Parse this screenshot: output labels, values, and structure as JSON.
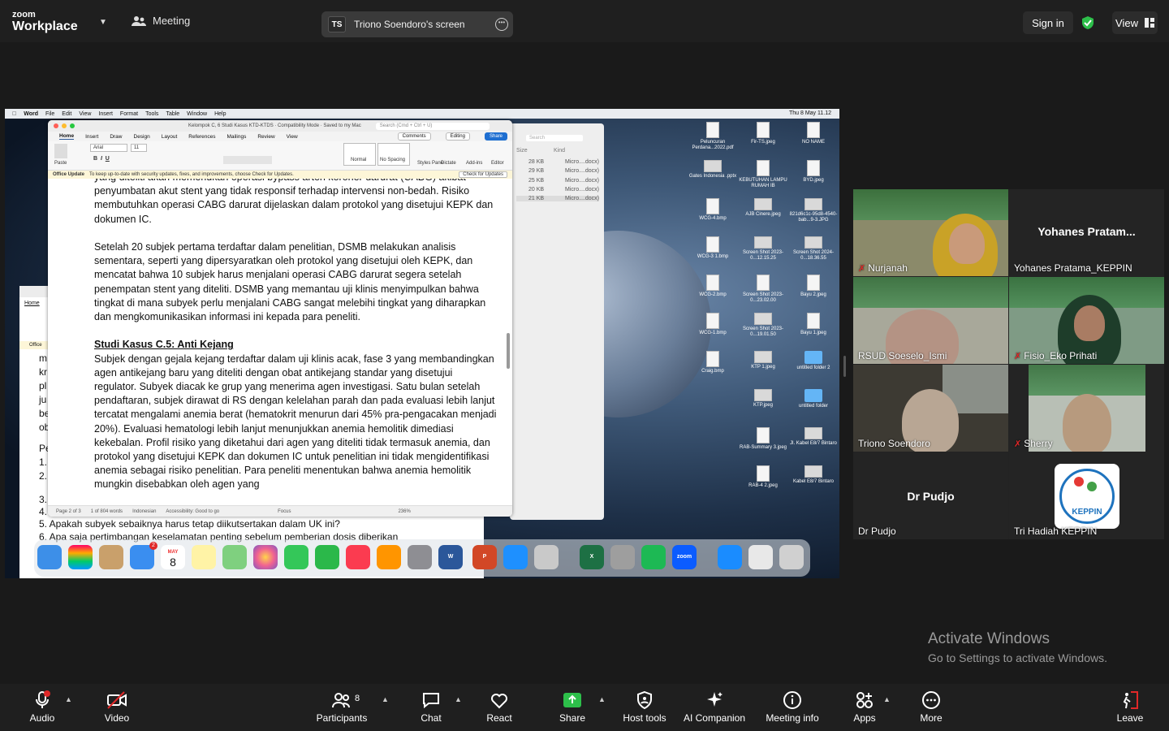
{
  "app": {
    "logo_line1": "zoom",
    "logo_line2": "Workplace",
    "meeting_label": "Meeting"
  },
  "share": {
    "initials": "TS",
    "label": "Triono Soendoro's screen"
  },
  "header_right": {
    "signin_label": "Sign in",
    "view_label": "View"
  },
  "mac": {
    "menus": [
      "Word",
      "File",
      "Edit",
      "View",
      "Insert",
      "Format",
      "Tools",
      "Table",
      "Window",
      "Help"
    ],
    "clock": "Thu 8 May 11.12"
  },
  "word": {
    "title": "Kelompok C, 6 Studi Kasus KTD-KTDS  ·  Compatibility Mode  ·  Saved to my Mac",
    "search_placeholder": "Search (Cmd + Ctrl + U)",
    "tabs": [
      "Home",
      "Insert",
      "Draw",
      "Design",
      "Layout",
      "References",
      "Mailings",
      "Review",
      "View"
    ],
    "comments_label": "Comments",
    "editing_label": "Editing",
    "share_label": "Share",
    "font": "Arial",
    "font_size": "11",
    "styles": [
      "Normal",
      "No Spacing"
    ],
    "ribbon_labels": [
      "Paste",
      "Styles Pane",
      "Dictate",
      "Add-ins",
      "Editor"
    ],
    "notice_title": "Office Update",
    "notice_text": "To keep up-to-date with security updates, fixes, and improvements, choose Check for Updates.",
    "notice_button": "Check for Updates",
    "paragraphs": [
      "yang diteliti akan memerlukan operasi bypass arteri koroner darurat (CABG) akibat penyumbatan akut stent yang tidak responsif terhadap intervensi non-bedah. Risiko membutuhkan operasi CABG darurat dijelaskan dalam protokol yang disetujui KEPK dan dokumen IC.",
      "Setelah 20 subjek pertama terdaftar dalam penelitian, DSMB melakukan analisis sementara, seperti yang dipersyaratkan oleh protokol yang disetujui oleh KEPK, dan mencatat bahwa 10 subjek harus menjalani operasi CABG darurat segera setelah penempatan stent yang diteliti. DSMB yang memantau uji klinis menyimpulkan bahwa tingkat di mana subyek perlu menjalani CABG sangat melebihi tingkat yang diharapkan dan mengkomunikasikan informasi ini kepada para peneliti."
    ],
    "heading": "Studi Kasus C.5: Anti Kejang",
    "paragraph3": "Subjek dengan gejala kejang terdaftar dalam uji klinis acak, fase 3 yang membandingkan agen antikejang baru yang diteliti dengan obat antikejang standar yang disetujui regulator. Subyek diacak ke grup yang menerima agen investigasi. Satu bulan setelah pendaftaran, subjek dirawat di RS dengan kelelahan parah dan pada evaluasi lebih lanjut tercatat mengalami anemia berat (hematokrit menurun dari 45% pra-pengacakan menjadi 20%). Evaluasi hematologi lebih lanjut menunjukkan anemia hemolitik dimediasi kekebalan. Profil risiko yang diketahui dari agen yang diteliti tidak termasuk anemia, dan protokol yang disetujui KEPK dan dokumen IC untuk penelitian ini tidak mengidentifikasi anemia sebagai risiko penelitian. Para peneliti menentukan bahwa anemia hemolitik mungkin disebabkan oleh agen yang",
    "status": [
      "Page 2 of 3",
      "1 of 804 words",
      "Indonesian",
      "Accessibility: Good to go",
      "Focus",
      "236%"
    ]
  },
  "doc_behind": {
    "tab": "Home",
    "notice": "Office",
    "lines_left": [
      "m",
      "kr",
      "pl",
      "ju",
      "be",
      "ob",
      "Pe",
      "1.",
      "2.",
      "3.",
      "4."
    ],
    "lines": [
      "5.   Apakah subyek sebaiknya harus tetap diikutsertakan dalam UK ini?",
      "6.   Apa saja pertimbangan keselamatan penting sebelum pemberian dosis diberikan"
    ]
  },
  "finder": {
    "search": "Search",
    "col_size": "Size",
    "col_kind": "Kind",
    "rows": [
      {
        "size": "28 KB",
        "kind": "Micro....docx)"
      },
      {
        "size": "29 KB",
        "kind": "Micro....docx)"
      },
      {
        "size": "25 KB",
        "kind": "Micro....docx)"
      },
      {
        "size": "20 KB",
        "kind": "Micro....docx)"
      },
      {
        "size": "21 KB",
        "kind": "Micro....docx)"
      }
    ]
  },
  "desktop_icons": [
    "Peluncuran Perdana...2022.pdf",
    "Fir-TS.jpeg",
    "NO NAME",
    "Gates Indonesia .pptx",
    "KEBUTUHAN LAMPU RUMAH IB",
    "BYD.jpeg",
    "WCG-4.bmp",
    "AJB Cinere.jpeg",
    "821d6c1c-95d8-4540-bab...9-3.JPG",
    "WCG-3 1.bmp",
    "Screen Shot 2023-0...12.15.25",
    "Screen Shot 2024-0...18.36.55",
    "WCG-2.bmp",
    "Screen Shot 2023-0...23.02.00",
    "Bayu 2.jpeg",
    "WCG-1.bmp",
    "Screen Shot 2023-0...19.01.50",
    "Bayu 1.jpeg",
    "Craig.bmp",
    "KTP 1.jpeg",
    "untitled folder 2",
    "KTP.jpeg",
    "untitled folder",
    "RAB-Summary 3.jpeg",
    "Jl. Kabel E8/7 Bintaro",
    "RAB-4 2.jpeg",
    "Kabel E8/7 Bintaro"
  ],
  "dock": {
    "calendar_month": "MAY",
    "calendar_day": "8",
    "mail_badge": "2",
    "apps": [
      "Finder",
      "Launchpad",
      "Contacts",
      "Mail",
      "Calendar",
      "Notes",
      "Maps",
      "Photos",
      "Messages",
      "FaceTime",
      "Music",
      "Books",
      "Settings",
      "Word",
      "PowerPoint",
      "Safari",
      "Preview",
      "Excel",
      "WhatsApp",
      "Spotify",
      "Zoom",
      "App Store",
      "Documents",
      "Trash"
    ],
    "zoom_label": "zoom"
  },
  "participants": [
    {
      "name": "Nurjanah",
      "muted": true
    },
    {
      "name": "Yohanes Pratama_KEPPIN",
      "big_name": "Yohanes  Pratam...",
      "muted": false
    },
    {
      "name": "RSUD Soeselo_Ismi",
      "muted": false
    },
    {
      "name": "Fisio_Eko Prihati",
      "muted": true
    },
    {
      "name": "Triono Soendoro",
      "muted": false,
      "active": true
    },
    {
      "name": "Sherry",
      "muted": true
    },
    {
      "name": "Dr Pudjo",
      "big_name": "Dr Pudjo",
      "muted": false
    },
    {
      "name": "Tri Hadiah KEPPIN",
      "logo_text": "KEPPIN",
      "muted": false
    }
  ],
  "watermark": {
    "line1": "Activate Windows",
    "line2": "Go to Settings to activate Windows."
  },
  "toolbar": {
    "audio": "Audio",
    "video": "Video",
    "participants": "Participants",
    "participants_count": "8",
    "chat": "Chat",
    "react": "React",
    "share": "Share",
    "host_tools": "Host tools",
    "ai_companion": "AI Companion",
    "meeting_info": "Meeting info",
    "apps": "Apps",
    "more": "More",
    "leave": "Leave"
  },
  "colors": {
    "accent_green": "#2ecc40",
    "share_green": "#2dbf4a",
    "mute_red": "#e02828",
    "zoom_blue": "#0b5cff"
  }
}
